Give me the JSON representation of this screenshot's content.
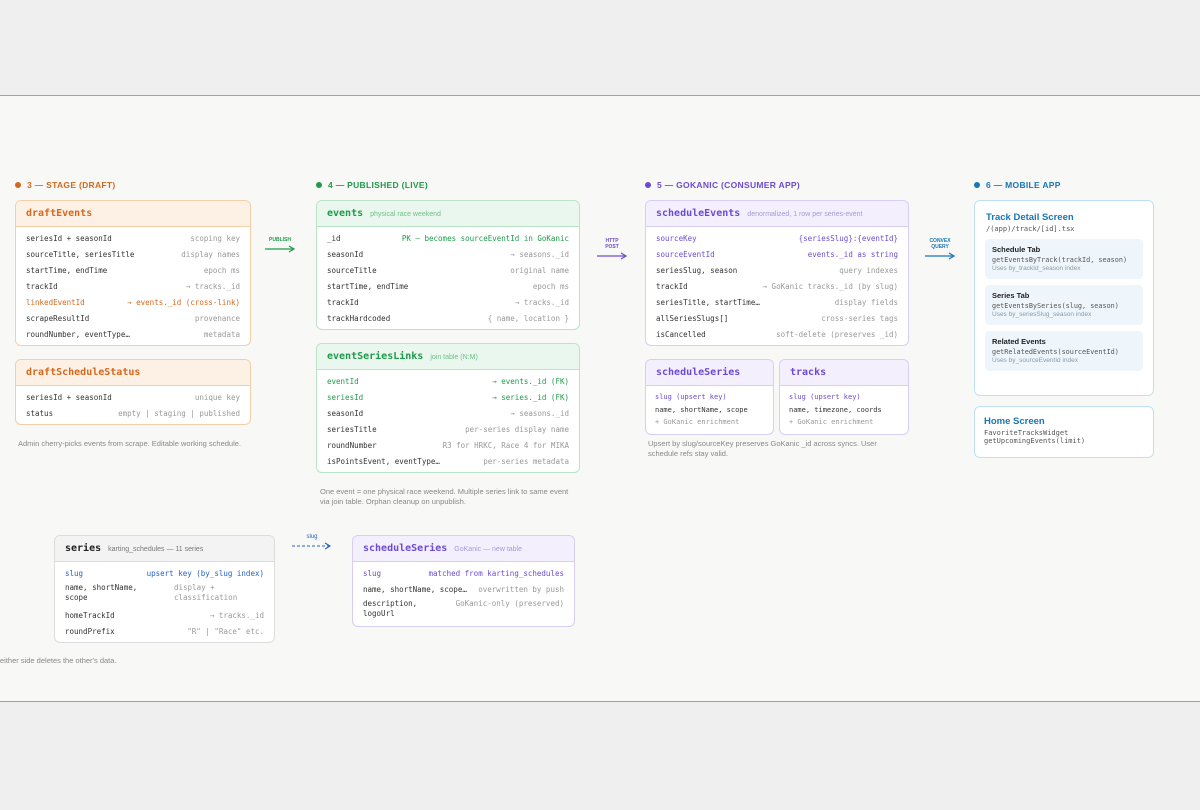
{
  "stages": {
    "stage3": {
      "label": "3 — STAGE (DRAFT)",
      "color": "#d4691c"
    },
    "stage4": {
      "label": "4 — PUBLISHED (LIVE)",
      "color": "#1f9a4a"
    },
    "stage5": {
      "label": "5 — GOKANIC (CONSUMER APP)",
      "color": "#6d4bd1"
    },
    "stage6": {
      "label": "6 — MOBILE APP",
      "color": "#1876b5"
    }
  },
  "draftEvents": {
    "title": "draftEvents",
    "rows": [
      {
        "k": "seriesId + seasonId",
        "v": "scoping key"
      },
      {
        "k": "sourceTitle, seriesTitle",
        "v": "display names"
      },
      {
        "k": "startTime, endTime",
        "v": "epoch ms"
      },
      {
        "k": "trackId",
        "v": "→ tracks._id"
      },
      {
        "k": "linkedEventId",
        "v": "→ events._id (cross-link)"
      },
      {
        "k": "scrapeResultId",
        "v": "provenance"
      },
      {
        "k": "roundNumber, eventType…",
        "v": "metadata"
      }
    ]
  },
  "draftScheduleStatus": {
    "title": "draftScheduleStatus",
    "rows": [
      {
        "k": "seriesId + seasonId",
        "v": "unique key"
      },
      {
        "k": "status",
        "v": "empty | staging | published"
      }
    ]
  },
  "stage3_note": "Admin cherry-picks events from scrape. Editable working schedule.",
  "events": {
    "title": "events",
    "subtitle": "physical race weekend",
    "rows": [
      {
        "k": "_id",
        "v": "PK — becomes sourceEventId in GoKanic"
      },
      {
        "k": "seasonId",
        "v": "→ seasons._id"
      },
      {
        "k": "sourceTitle",
        "v": "original name"
      },
      {
        "k": "startTime, endTime",
        "v": "epoch ms"
      },
      {
        "k": "trackId",
        "v": "→ tracks._id"
      },
      {
        "k": "trackHardcoded",
        "v": "{ name, location }"
      }
    ]
  },
  "eventSeriesLinks": {
    "title": "eventSeriesLinks",
    "subtitle": "join table (N:M)",
    "rows": [
      {
        "k": "eventId",
        "v": "→ events._id (FK)"
      },
      {
        "k": "seriesId",
        "v": "→ series._id (FK)"
      },
      {
        "k": "seasonId",
        "v": "→ seasons._id"
      },
      {
        "k": "seriesTitle",
        "v": "per-series display name"
      },
      {
        "k": "roundNumber",
        "v": "R3 for HRKC, Race 4 for MIKA"
      },
      {
        "k": "isPointsEvent, eventType…",
        "v": "per-series metadata"
      }
    ]
  },
  "stage4_note": "One event = one physical race weekend. Multiple series link to same event via join table. Orphan cleanup on unpublish.",
  "scheduleEvents": {
    "title": "scheduleEvents",
    "subtitle": "denormalized, 1 row per series-event",
    "rows": [
      {
        "k": "sourceKey",
        "v": "{seriesSlug}:{eventId}"
      },
      {
        "k": "sourceEventId",
        "v": "events._id as string"
      },
      {
        "k": "seriesSlug, season",
        "v": "query indexes"
      },
      {
        "k": "trackId",
        "v": "→ GoKanic tracks._id (by slug)"
      },
      {
        "k": "seriesTitle, startTime…",
        "v": "display fields"
      },
      {
        "k": "allSeriesSlugs[]",
        "v": "cross-series tags"
      },
      {
        "k": "isCancelled",
        "v": "soft-delete (preserves _id)"
      }
    ]
  },
  "scheduleSeriesSmall": {
    "title": "scheduleSeries",
    "lines": [
      "slug (upsert key)",
      "name, shortName, scope",
      "+ GoKanic enrichment"
    ]
  },
  "tracks": {
    "title": "tracks",
    "lines": [
      "slug (upsert key)",
      "name, timezone, coords",
      "+ GoKanic enrichment"
    ]
  },
  "stage5_note": "Upsert by slug/sourceKey preserves GoKanic _id across syncs. User schedule refs stay valid.",
  "trackDetail": {
    "title": "Track Detail Screen",
    "path": "/(app)/track/[id].tsx",
    "tabs": [
      {
        "title": "Schedule Tab",
        "method": "getEventsByTrack(trackId, season)",
        "uses": "Uses by_trackId_season index"
      },
      {
        "title": "Series Tab",
        "method": "getEventsBySeries(slug, season)",
        "uses": "Uses by_seriesSlug_season index"
      },
      {
        "title": "Related Events",
        "method": "getRelatedEvents(sourceEventId)",
        "uses": "Uses by_sourceEventId index"
      }
    ]
  },
  "homeScreen": {
    "title": "Home Screen",
    "lines": [
      "FavoriteTracksWidget",
      "getUpcomingEvents(limit)"
    ]
  },
  "arrows": {
    "publish": "PUBLISH",
    "http1": "HTTP",
    "http2": "POST",
    "convex1": "CONVEX",
    "convex2": "QUERY",
    "slug": "slug"
  },
  "series": {
    "title": "series",
    "subtitle": "karting_schedules — 11 series",
    "rows": [
      {
        "k": "slug",
        "v": "upsert key (by_slug index)"
      },
      {
        "k": "name, shortName, scope",
        "v": "display + classification"
      },
      {
        "k": "homeTrackId",
        "v": "→ tracks._id"
      },
      {
        "k": "roundPrefix",
        "v": "\"R\" | \"Race\" etc."
      }
    ]
  },
  "scheduleSeriesBottom": {
    "title": "scheduleSeries",
    "subtitle": "GoKanic — new table",
    "rows": [
      {
        "k": "slug",
        "v": "matched from karting_schedules"
      },
      {
        "k": "name, shortName, scope…",
        "v": "overwritten by push"
      },
      {
        "k": "description, logoUrl",
        "v": "GoKanic-only (preserved)"
      }
    ]
  },
  "bottom_note": "either side deletes the other's data."
}
